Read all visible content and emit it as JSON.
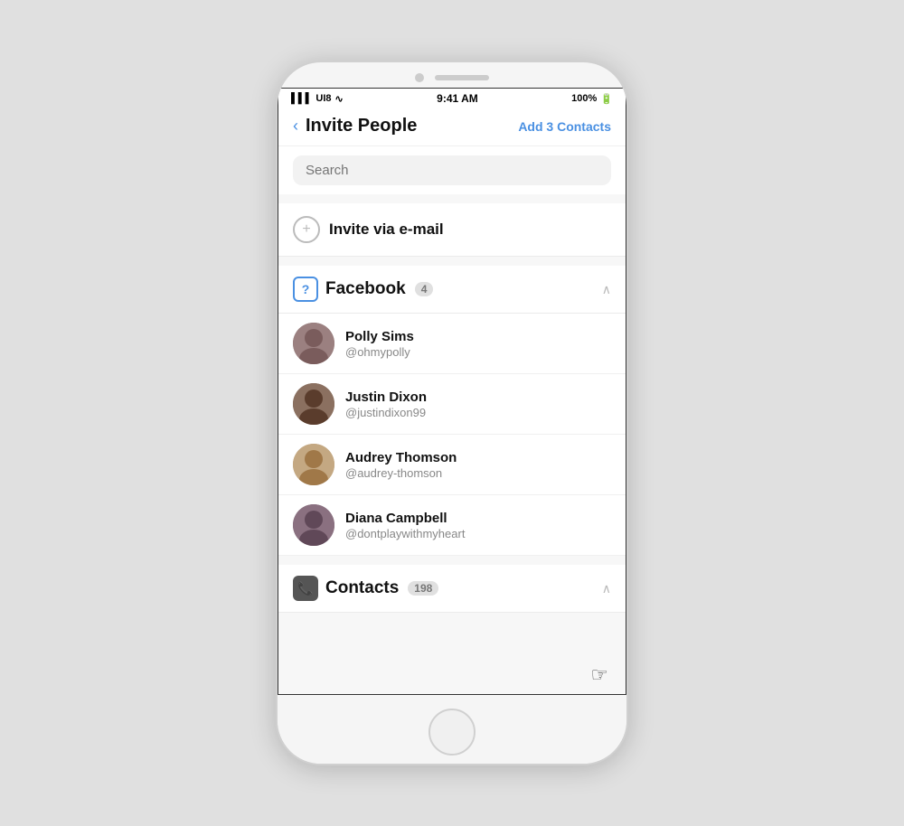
{
  "statusBar": {
    "signal": "UI8",
    "wifi": "wifi",
    "time": "9:41 AM",
    "battery": "100%"
  },
  "header": {
    "backLabel": "‹",
    "title": "Invite People",
    "actionLabel": "Add 3 Contacts"
  },
  "search": {
    "placeholder": "Search"
  },
  "inviteEmail": {
    "label": "Invite via e-mail",
    "icon": "+"
  },
  "sections": [
    {
      "id": "facebook",
      "title": "Facebook",
      "count": "4",
      "iconSymbol": "?",
      "collapsed": false,
      "contacts": [
        {
          "name": "Polly Sims",
          "handle": "@ohmypolly",
          "avatarColor": "#8B6060"
        },
        {
          "name": "Justin Dixon",
          "handle": "@justindixon99",
          "avatarColor": "#6B5040"
        },
        {
          "name": "Audrey Thomson",
          "handle": "@audrey-thomson",
          "avatarColor": "#C4A882"
        },
        {
          "name": "Diana Campbell",
          "handle": "@dontplaywithmyheart",
          "avatarColor": "#7A6070"
        }
      ]
    },
    {
      "id": "contacts",
      "title": "Contacts",
      "count": "198",
      "iconSymbol": "📞",
      "collapsed": false,
      "contacts": []
    }
  ]
}
